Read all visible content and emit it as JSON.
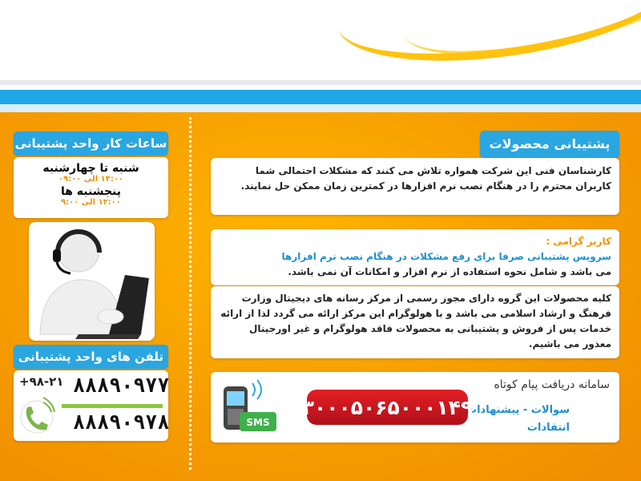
{
  "hours": {
    "title": "ساعات کار واحد پشتیبانی",
    "day1": "شنبه تا چهارشنبه",
    "time1": "۱۴:۰۰ الی ۰۹:۰۰",
    "day2": "پنجشنبه ها",
    "time2": "۱۲:۰۰ الی ۹:۰۰"
  },
  "phones": {
    "title": "تلفن های واحد پشتیبانی",
    "code": "+۹۸-۲۱",
    "phone1": "۸۸۸۹۰۹۷۷",
    "phone2": "۸۸۸۹۰۹۷۸"
  },
  "support": {
    "title": "پشتیبانی محصولات",
    "text": "کارشناسان فنی این شرکت همواره تلاش می کنند که مشکلات احتمالی شما کاربران محترم را در هنگام نصب نرم افزارها در کمترین زمان ممکن حل نمایند."
  },
  "notice": {
    "greeting": "کاربر گرامی :",
    "blue_text": "سرویس پشتیبانی صرفا برای رفع مشکلات در هنگام نصب نرم افزارها",
    "dark_text": "می باشد و شامل نحوه استفاده از نرم افزار و امکانات آن نمی باشد."
  },
  "license": {
    "text": "کلیه محصولات این گروه دارای مجوز رسمی از مرکز رسانه های دیجیتال وزارت فرهنگ و ارشاد اسلامی می باشد و با هولوگرام این مرکز ارائه می گردد لذا از ارائه خدمات پس از فروش و پشتیبانی به محصولات فاقد هولوگرام و غیر اورجینال معذور می باشیم."
  },
  "sms": {
    "label": "سامانه دریافت پیام کوتاه",
    "number": "۳۰۰۰۵۰۶۵۰۰۰۱۴۹",
    "topics_line1": "سوالات - پیشنهادات",
    "topics_line2": "انتقادات",
    "badge": "SMS"
  },
  "colors": {
    "accent_blue": "#2aa6e0",
    "orange": "#f6a300",
    "red": "#e31e24"
  }
}
